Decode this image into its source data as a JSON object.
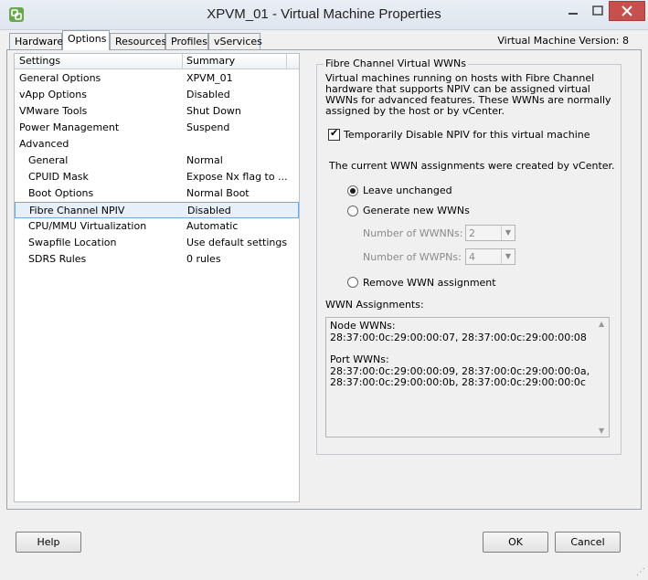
{
  "window": {
    "title": "XPVM_01 - Virtual Machine Properties",
    "icon": "vsphere-app-icon",
    "controls": [
      "minimize-icon",
      "maximize-icon",
      "close-icon"
    ]
  },
  "tabs": [
    {
      "label": "Hardware",
      "active": false
    },
    {
      "label": "Options",
      "active": true
    },
    {
      "label": "Resources",
      "active": false
    },
    {
      "label": "Profiles",
      "active": false
    },
    {
      "label": "vServices",
      "active": false
    }
  ],
  "vm_version": "Virtual Machine Version: 8",
  "settings_list": {
    "headers": [
      "Settings",
      "Summary"
    ],
    "rows": [
      {
        "setting": "General Options",
        "summary": "XPVM_01",
        "indent": false
      },
      {
        "setting": "vApp Options",
        "summary": "Disabled",
        "indent": false
      },
      {
        "setting": "VMware Tools",
        "summary": "Shut Down",
        "indent": false
      },
      {
        "setting": "Power Management",
        "summary": "Suspend",
        "indent": false
      },
      {
        "setting": "Advanced",
        "summary": "",
        "indent": false
      },
      {
        "setting": "General",
        "summary": "Normal",
        "indent": true
      },
      {
        "setting": "CPUID Mask",
        "summary": "Expose Nx flag to ...",
        "indent": true
      },
      {
        "setting": "Boot Options",
        "summary": "Normal Boot",
        "indent": true
      },
      {
        "setting": "Fibre Channel NPIV",
        "summary": "Disabled",
        "indent": true,
        "selected": true
      },
      {
        "setting": "CPU/MMU Virtualization",
        "summary": "Automatic",
        "indent": true
      },
      {
        "setting": "Swapfile Location",
        "summary": "Use default settings",
        "indent": true
      },
      {
        "setting": "SDRS Rules",
        "summary": "0 rules",
        "indent": true
      }
    ]
  },
  "fc_panel": {
    "group_title": "Fibre Channel Virtual WWNs",
    "description": "Virtual machines running on hosts with Fibre Channel hardware that supports NPIV can be assigned virtual WWNs for advanced features. These WWNs are normally assigned by the host or by vCenter.",
    "disable_npiv_label": "Temporarily Disable NPIV for this virtual machine",
    "disable_npiv_checked": true,
    "current_assignment_text": "The current WWN assignments were created by vCenter.",
    "radio_leave": "Leave unchanged",
    "radio_generate": "Generate new WWNs",
    "radio_remove": "Remove WWN assignment",
    "selected_radio": "leave",
    "wwnn_label": "Number of WWNNs:",
    "wwnn_value": "2",
    "wwpn_label": "Number of WWPNs:",
    "wwpn_value": "4",
    "wwn_assignments_label": "WWN Assignments:",
    "node_wwns_label": "Node WWNs:",
    "node_wwns": "28:37:00:0c:29:00:00:07, 28:37:00:0c:29:00:00:08",
    "port_wwns_label": "Port WWNs:",
    "port_wwns_line1": "28:37:00:0c:29:00:00:09, 28:37:00:0c:29:00:00:0a,",
    "port_wwns_line2": "28:37:00:0c:29:00:00:0b, 28:37:00:0c:29:00:00:0c"
  },
  "buttons": {
    "help": "Help",
    "ok": "OK",
    "cancel": "Cancel"
  }
}
